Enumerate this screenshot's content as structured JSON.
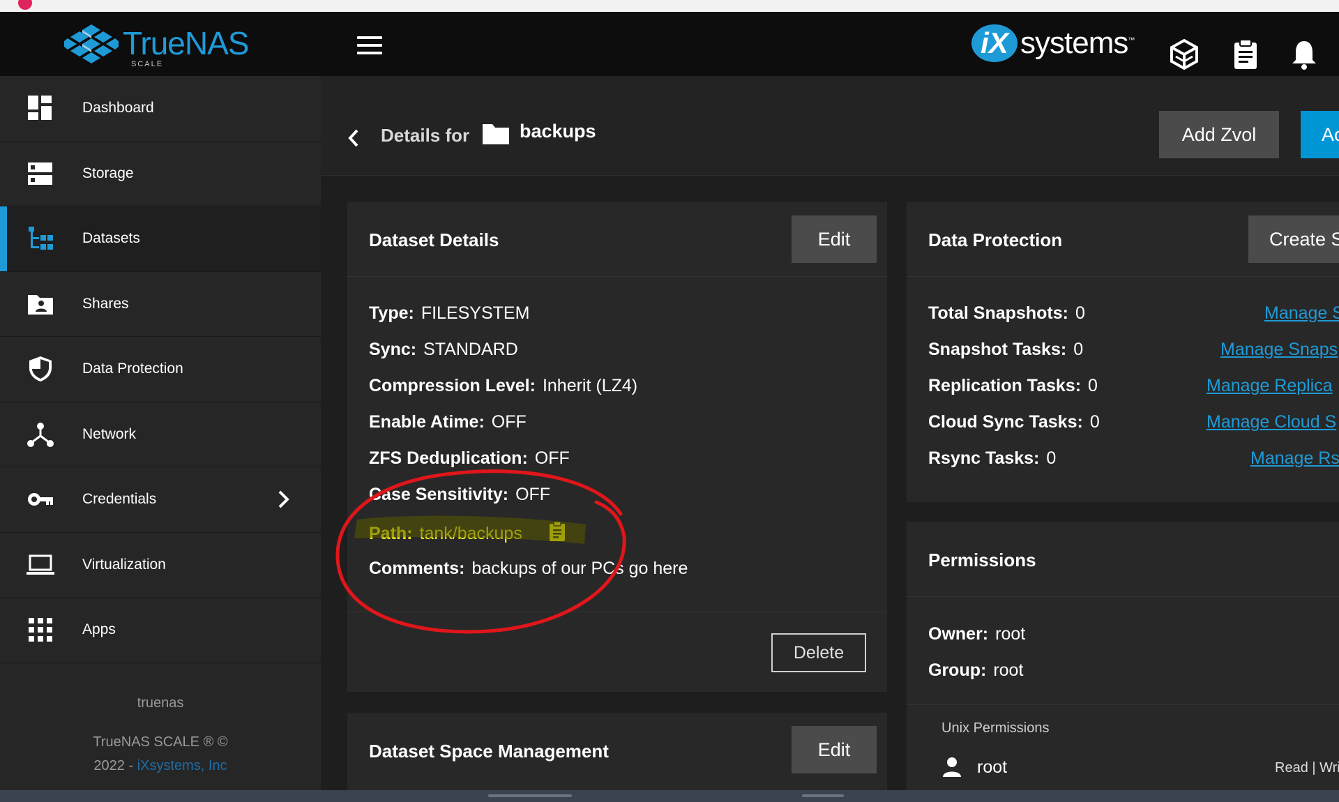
{
  "header": {
    "logo_word": "TrueNAS",
    "logo_sub": "SCALE",
    "ix_word": "systems",
    "ix_tm": "™",
    "icons": [
      "truecommand-icon",
      "clipboard-icon",
      "bell-icon"
    ]
  },
  "sidebar": {
    "items": [
      {
        "label": "Dashboard",
        "icon": "dashboard-icon"
      },
      {
        "label": "Storage",
        "icon": "storage-icon"
      },
      {
        "label": "Datasets",
        "icon": "datasets-icon"
      },
      {
        "label": "Shares",
        "icon": "shares-icon"
      },
      {
        "label": "Data Protection",
        "icon": "shield-icon"
      },
      {
        "label": "Network",
        "icon": "network-icon"
      },
      {
        "label": "Credentials",
        "icon": "key-icon"
      },
      {
        "label": "Virtualization",
        "icon": "laptop-icon"
      },
      {
        "label": "Apps",
        "icon": "apps-grid-icon"
      }
    ],
    "active_index": 2,
    "hostname": "truenas",
    "copyright_line1": "TrueNAS SCALE ® ©",
    "copyright_year": "2022 - ",
    "copyright_company": "iXsystems, Inc"
  },
  "page": {
    "details_for": "Details for",
    "dataset_name": "backups",
    "add_zvol_label": "Add Zvol",
    "add_label": "Ac"
  },
  "dataset_details": {
    "title": "Dataset Details",
    "edit_label": "Edit",
    "rows": [
      {
        "key": "Type:",
        "value": "FILESYSTEM"
      },
      {
        "key": "Sync:",
        "value": "STANDARD"
      },
      {
        "key": "Compression Level:",
        "value": "Inherit (LZ4)"
      },
      {
        "key": "Enable Atime:",
        "value": "OFF"
      },
      {
        "key": "ZFS Deduplication:",
        "value": "OFF"
      },
      {
        "key": "Case Sensitivity:",
        "value": "OFF"
      },
      {
        "key": "Path:",
        "value": "tank/backups"
      },
      {
        "key": "Comments:",
        "value": "backups of our PCs go here"
      }
    ],
    "delete_label": "Delete"
  },
  "space_management": {
    "title": "Dataset Space Management",
    "edit_label": "Edit"
  },
  "data_protection": {
    "title": "Data Protection",
    "create_label": "Create S",
    "rows": [
      {
        "key": "Total Snapshots:",
        "value": "0",
        "link": "Manage S"
      },
      {
        "key": "Snapshot Tasks:",
        "value": "0",
        "link": "Manage Snaps"
      },
      {
        "key": "Replication Tasks:",
        "value": "0",
        "link": "Manage Replica"
      },
      {
        "key": "Cloud Sync Tasks:",
        "value": "0",
        "link": "Manage Cloud S"
      },
      {
        "key": "Rsync Tasks:",
        "value": "0",
        "link": "Manage Rs"
      }
    ]
  },
  "permissions": {
    "title": "Permissions",
    "owner_key": "Owner:",
    "owner_value": "root",
    "group_key": "Group:",
    "group_value": "root",
    "unix_label": "Unix Permissions",
    "user_name": "root",
    "user_perm": "Read | Wri"
  },
  "colors": {
    "accent": "#1e9bd7",
    "highlight_text": "#f3f21a",
    "annotation_red": "#e0161b",
    "annotation_marker": "#5a5a00"
  }
}
